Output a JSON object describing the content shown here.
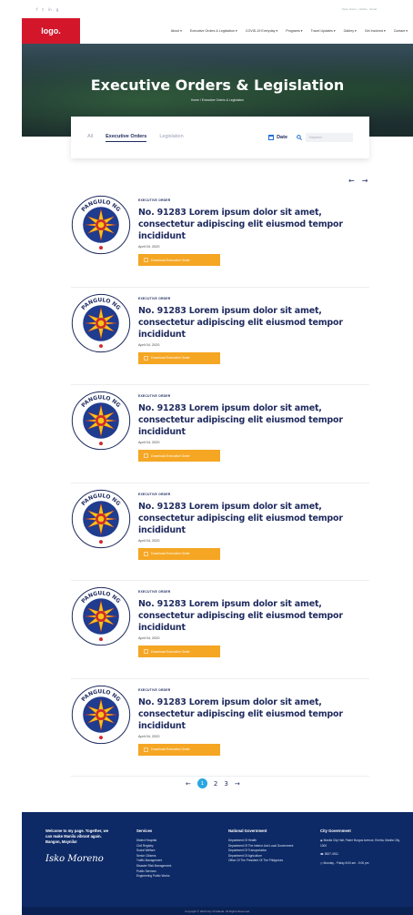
{
  "topbar": {
    "social": [
      "f",
      "t",
      "in",
      "g"
    ],
    "info": "Open Hours · Hotline · Email"
  },
  "nav": {
    "logo": "logo.",
    "menu": [
      "About ▾",
      "Executive Orders & Legislation ▾",
      "COVID-19 Everyday ▾",
      "Programs ▾",
      "Travel Updates ▾",
      "Gallery ▾",
      "Get Involved ▾",
      "Contact ▾"
    ]
  },
  "hero": {
    "title": "Executive Orders & Legislation",
    "breadcrumb": "Home / Executive Orders & Legislation"
  },
  "filter": {
    "tabs": [
      "All",
      "Executive Orders",
      "Legislation"
    ],
    "date_label": "Date",
    "search_placeholder": "Keyword"
  },
  "arrows": {
    "prev": "←",
    "next": "→"
  },
  "cards": [
    {
      "kicker": "EXECUTIVE ORDER",
      "title": "No. 91283 Lorem ipsum dolor sit amet, consectetur adipiscing elit eiusmod tempor incididunt",
      "date": "April 04, 2020",
      "button": "Download Executive Order"
    },
    {
      "kicker": "EXECUTIVE ORDER",
      "title": "No. 91283 Lorem ipsum dolor sit amet, consectetur adipiscing elit eiusmod tempor incididunt",
      "date": "April 04, 2020",
      "button": "Download Executive Order"
    },
    {
      "kicker": "EXECUTIVE ORDER",
      "title": "No. 91283 Lorem ipsum dolor sit amet, consectetur adipiscing elit eiusmod tempor incididunt",
      "date": "April 04, 2020",
      "button": "Download Executive Order"
    },
    {
      "kicker": "EXECUTIVE ORDER",
      "title": "No. 91283 Lorem ipsum dolor sit amet, consectetur adipiscing elit eiusmod tempor incididunt",
      "date": "April 04, 2020",
      "button": "Download Executive Order"
    },
    {
      "kicker": "EXECUTIVE ORDER",
      "title": "No. 91283 Lorem ipsum dolor sit amet, consectetur adipiscing elit eiusmod tempor incididunt",
      "date": "April 04, 2020",
      "button": "Download Executive Order"
    },
    {
      "kicker": "EXECUTIVE ORDER",
      "title": "No. 91283 Lorem ipsum dolor sit amet, consectetur adipiscing elit eiusmod tempor incididunt",
      "date": "April 04, 2020",
      "button": "Download Executive Order"
    }
  ],
  "seal": {
    "text_top": "PANGULO NG",
    "text_left": "SAGISAG NG",
    "text_right": "PILIPINAS"
  },
  "pager": {
    "prev": "←",
    "pages": [
      "1",
      "2",
      "3"
    ],
    "next": "→"
  },
  "footer": {
    "tagline": "Welcome to my page. Together, we can make Manila vibrant again. Bangon, Maynila!",
    "signature": "Isko Moreno",
    "services": {
      "heading": "Services",
      "items": [
        "District Hospital",
        "Civil Registry",
        "Social Welfare",
        "Senior Citizens",
        "Traffic Management",
        "Disaster Risk Management",
        "Public Services",
        "Engineering Public Works"
      ]
    },
    "national": {
      "heading": "National Government",
      "items": [
        "Department Of Health",
        "Department Of The Interior And Local Government",
        "Department Of Transportation",
        "Department Of Agriculture",
        "Office Of The President Of The Philippines"
      ]
    },
    "city": {
      "heading": "City Government",
      "address": "Manila City Hall, Padre Burgos Avenue, Ermita, Manila City, 1000",
      "phone": "8527-4911",
      "hours": "Monday - Friday 8:00 am - 5:00 pm"
    },
    "copyright": "Copyright © 2020 City Of Manila. All Rights Reserved."
  },
  "colors": {
    "brand_red": "#d4162b",
    "navy": "#1e2a5e",
    "accent_orange": "#f5a623",
    "footer_navy": "#0d2a66",
    "page_active": "#2aa6e0"
  }
}
